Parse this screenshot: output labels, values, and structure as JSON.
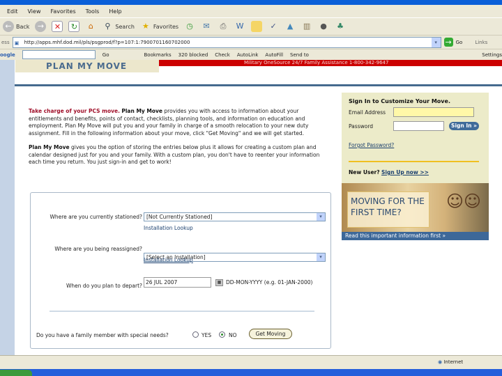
{
  "browser": {
    "menu": [
      "Edit",
      "View",
      "Favorites",
      "Tools",
      "Help"
    ],
    "toolbar": {
      "back": "Back",
      "search": "Search",
      "favorites": "Favorites"
    },
    "address_label": "ess",
    "url": "http://apps.mhf.dod.mil/pls/psgprod/f?p=107:1:7900701160702000",
    "go": "Go",
    "links": "Links",
    "google": {
      "logo": "oogle",
      "go": "Go",
      "bookmarks": "Bookmarks",
      "blocked": "320 blocked",
      "check": "Check",
      "autolink": "AutoLink",
      "autofill": "AutoFill",
      "sendto": "Send to",
      "settings": "Settings"
    },
    "status": {
      "zone": "Internet"
    }
  },
  "page": {
    "logo": "PLAN MY MOVE",
    "banner": "Military OneSource 24/7 Family Assistance 1-800-342-9647",
    "intro": {
      "lead": "Take charge of your PCS move.",
      "brand": "Plan My Move",
      "p1": " provides you with access to information about your entitlements and benefits, points of contact, checklists, planning tools, and information on education and employment. Plan My Move will put you and your family in charge of a smooth relocation to your new duty assignment. Fill in the following information about your move, click \"Get Moving\" and we will get started.",
      "p2": " gives you the option of storing the entries below plus it allows for creating a custom plan and calendar designed just for you and your family. With a custom plan, you don't have to reenter your information each time you return. You just sign-in and get to work!"
    },
    "signin": {
      "title": "Sign In to Customize Your Move.",
      "email_label": "Email Address",
      "email_value": "",
      "password_label": "Password",
      "password_value": "",
      "button": "Sign In »",
      "forgot": "Forgot Password?",
      "new_user": "New User?",
      "signup": "Sign Up now >>",
      "promo": "MOVING FOR THE FIRST TIME?",
      "promo_link": "Read this important information first »"
    },
    "form": {
      "stationed_label": "Where are you currently stationed?",
      "stationed_value": "[Not Currently Stationed]",
      "lookup1": "Installation Lookup",
      "reassigned_label": "Where are you being reassigned?",
      "reassigned_value": "[Select an Installation]",
      "lookup2": "Installation Lookup",
      "depart_label": "When do you plan to depart?",
      "depart_value": "26 JUL 2007",
      "date_hint": "DD-MON-YYYY (e.g. 01-JAN-2000)",
      "special_label": "Do you have a family member with special needs?",
      "yes": "YES",
      "no": "NO",
      "selected": "NO",
      "submit": "Get Moving"
    }
  }
}
